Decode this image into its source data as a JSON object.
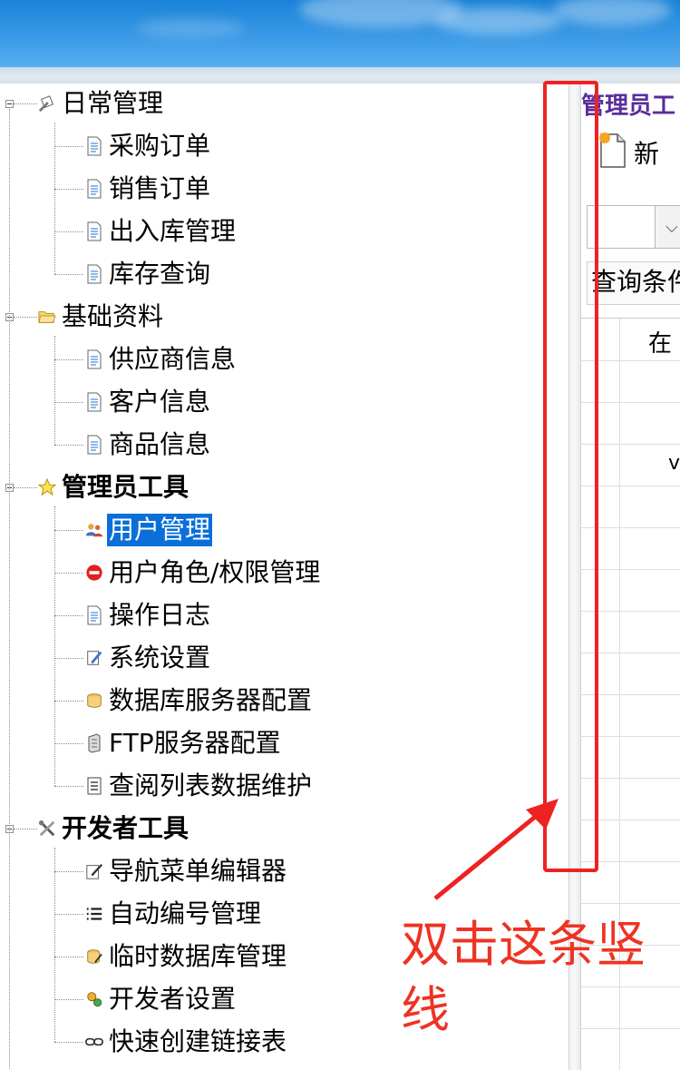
{
  "tree": {
    "groups": [
      {
        "label": "日常管理",
        "icon": "wrench-paper-icon",
        "bold": false,
        "items": [
          {
            "label": "采购订单",
            "icon": "document-icon"
          },
          {
            "label": "销售订单",
            "icon": "document-icon"
          },
          {
            "label": "出入库管理",
            "icon": "document-icon"
          },
          {
            "label": "库存查询",
            "icon": "document-icon"
          }
        ]
      },
      {
        "label": "基础资料",
        "icon": "folder-open-icon",
        "bold": false,
        "items": [
          {
            "label": "供应商信息",
            "icon": "document-icon"
          },
          {
            "label": "客户信息",
            "icon": "document-icon"
          },
          {
            "label": "商品信息",
            "icon": "document-icon"
          }
        ]
      },
      {
        "label": "管理员工具",
        "icon": "star-icon",
        "bold": true,
        "items": [
          {
            "label": "用户管理",
            "icon": "users-icon",
            "selected": true
          },
          {
            "label": "用户角色/权限管理",
            "icon": "no-entry-icon"
          },
          {
            "label": "操作日志",
            "icon": "document-icon"
          },
          {
            "label": "系统设置",
            "icon": "settings-pen-icon"
          },
          {
            "label": "数据库服务器配置",
            "icon": "database-icon"
          },
          {
            "label": "FTP服务器配置",
            "icon": "server-icon"
          },
          {
            "label": "查阅列表数据维护",
            "icon": "list-icon"
          }
        ]
      },
      {
        "label": "开发者工具",
        "icon": "tools-icon",
        "bold": true,
        "items": [
          {
            "label": "导航菜单编辑器",
            "icon": "edit-icon"
          },
          {
            "label": "自动编号管理",
            "icon": "numbered-list-icon"
          },
          {
            "label": "临时数据库管理",
            "icon": "temp-db-icon"
          },
          {
            "label": "开发者设置",
            "icon": "developer-settings-icon"
          },
          {
            "label": "快速创建链接表",
            "icon": "link-icon"
          }
        ]
      }
    ]
  },
  "right_panel": {
    "title": "管理员工",
    "new_button_label": "新",
    "query_label": "查询条件",
    "column_header": "在",
    "cell_text": "v"
  },
  "annotation": {
    "text": "双击这条竖线",
    "color": "#ee3322"
  },
  "colors": {
    "selection": "#0a6fd8",
    "title": "#5a2c9c",
    "banner": "#2a8ee0"
  }
}
